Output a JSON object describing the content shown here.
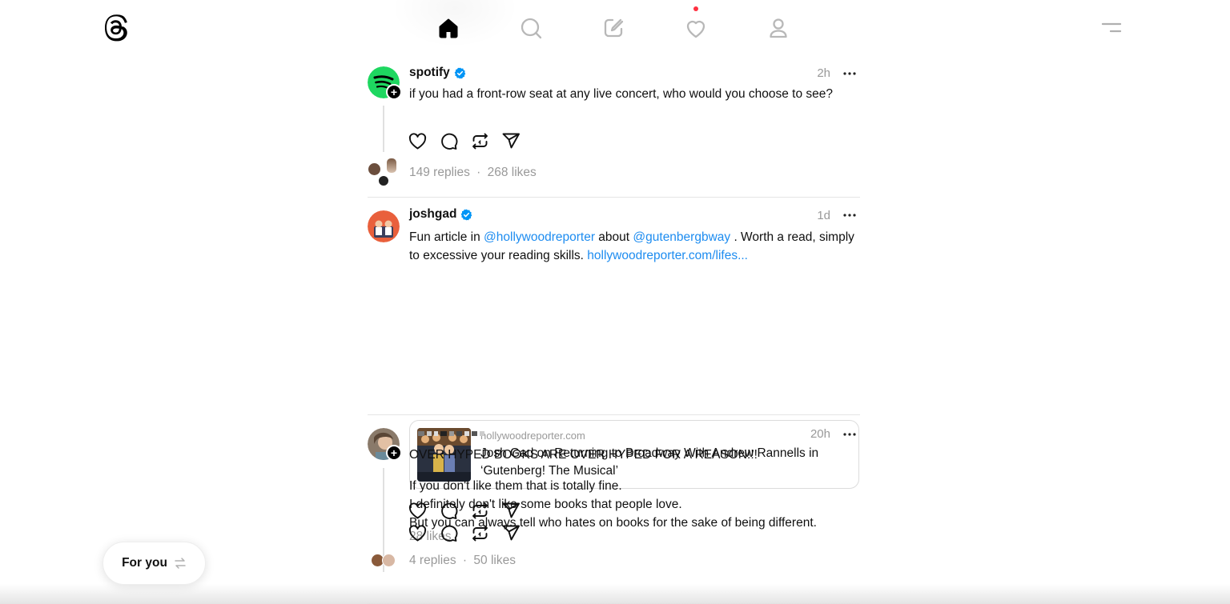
{
  "nav": {
    "items": [
      "home",
      "search",
      "compose",
      "activity",
      "profile"
    ]
  },
  "posts": [
    {
      "username": "spotify",
      "time": "2h",
      "text": "if you had a front-row seat at any live concert, who would you choose to see?",
      "replies": "149 replies",
      "separator": "·",
      "likes": "268 likes"
    },
    {
      "username": "joshgad",
      "time": "1d",
      "text_before": "Fun article in ",
      "mention1": "@hollywoodreporter",
      "text_mid": " about ",
      "mention2": "@gutenbergbway",
      "text_after": " . Worth a read, simply to excessive your reading skills. ",
      "url": "hollywoodreporter.com/lifes...",
      "card": {
        "domain": "hollywoodreporter.com",
        "title": "Josh Gad on Returning to Broadway With Andrew Rannells in ‘Gutenberg! The Musical’"
      },
      "likes": "28 likes"
    },
    {
      "username": "",
      "time": "20h",
      "line1": "OVER HYPED BOOKS ARE OVER HYPED FOR A REASON!!!",
      "line2": "If you don't like them that is totally fine.",
      "line3": "I definitely don't like some books that people love.",
      "line4": "But you can always tell who hates on books for the sake of being different.",
      "replies": "4 replies",
      "separator": "·",
      "likes": "50 likes"
    }
  ],
  "feed_switch": {
    "label": "For you"
  },
  "colors": {
    "link": "#1d8cf0",
    "verified": "#0095f6",
    "spotify": "#1ed760",
    "notification": "#ff3040",
    "muted": "#999999"
  }
}
